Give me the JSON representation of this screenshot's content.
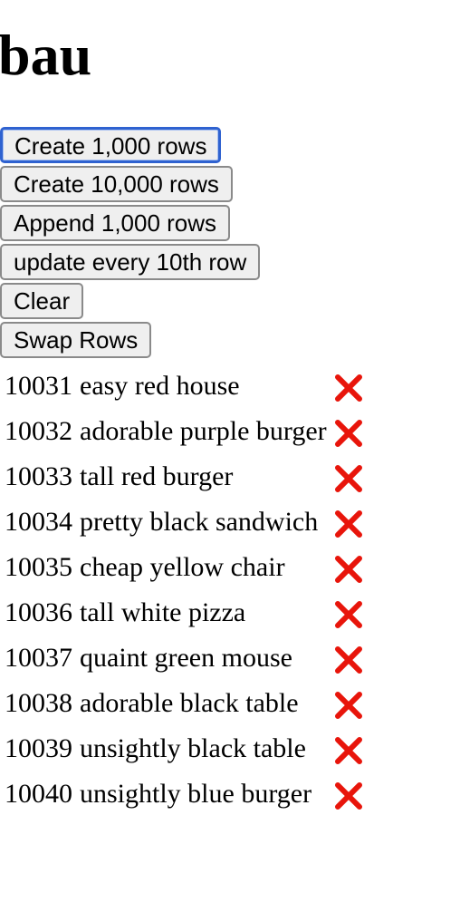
{
  "page": {
    "title": "bau"
  },
  "buttons": [
    {
      "id": "run",
      "label": "Create 1,000 rows",
      "focused": true
    },
    {
      "id": "runlots",
      "label": "Create 10,000 rows",
      "focused": false
    },
    {
      "id": "add",
      "label": "Append 1,000 rows",
      "focused": false
    },
    {
      "id": "update",
      "label": "update every 10th row",
      "focused": false
    },
    {
      "id": "clear",
      "label": "Clear",
      "focused": false
    },
    {
      "id": "swaprows",
      "label": "Swap Rows",
      "focused": false
    }
  ],
  "rows": [
    {
      "id": "10031",
      "label": "easy red house"
    },
    {
      "id": "10032",
      "label": "adorable purple burger"
    },
    {
      "id": "10033",
      "label": "tall red burger"
    },
    {
      "id": "10034",
      "label": "pretty black sandwich"
    },
    {
      "id": "10035",
      "label": "cheap yellow chair"
    },
    {
      "id": "10036",
      "label": "tall white pizza"
    },
    {
      "id": "10037",
      "label": "quaint green mouse"
    },
    {
      "id": "10038",
      "label": "adorable black table"
    },
    {
      "id": "10039",
      "label": "unsightly black table"
    },
    {
      "id": "10040",
      "label": "unsightly blue burger"
    }
  ],
  "icons": {
    "delete": "close-icon",
    "delete_color": "#e8150b"
  }
}
